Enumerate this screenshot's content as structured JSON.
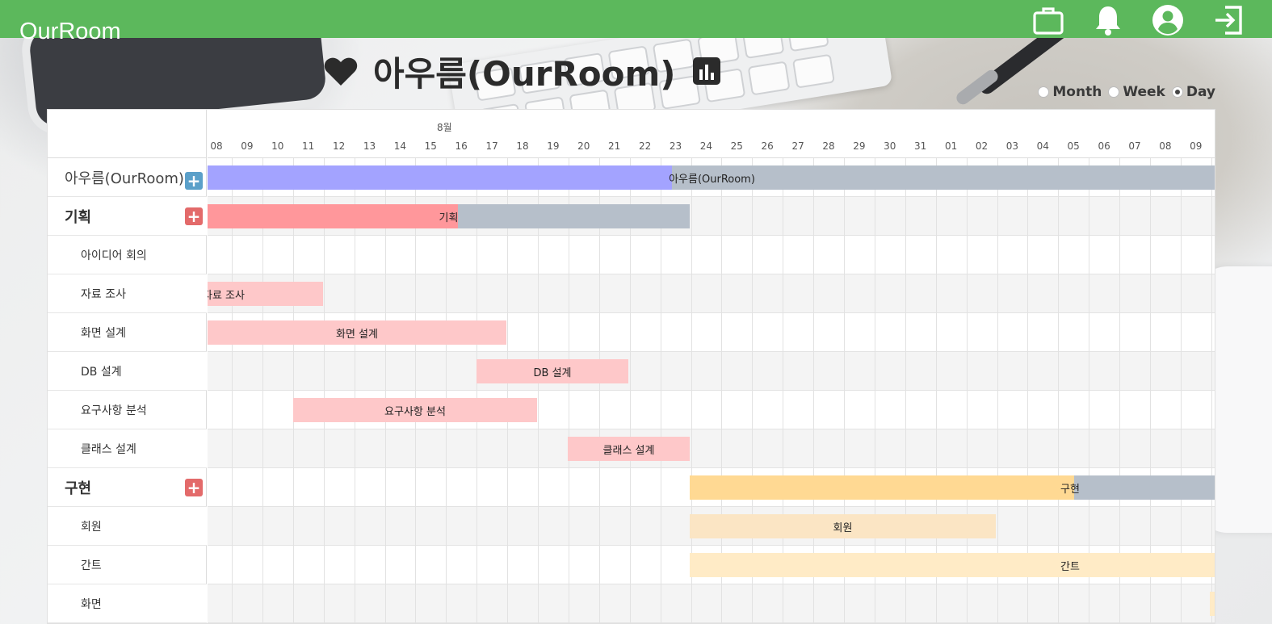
{
  "navbar": {
    "brand": "OurRoom",
    "icons": [
      "briefcase-icon",
      "bell-icon",
      "user-circle-icon",
      "sign-out-icon"
    ],
    "color": "#5cb85c"
  },
  "header": {
    "title": "아우름(OurRoom)",
    "heart_icon": "heart-icon",
    "stats_icon": "bar-chart-icon"
  },
  "view_modes": {
    "options": [
      {
        "label": "Month",
        "checked": false
      },
      {
        "label": "Week",
        "checked": false
      },
      {
        "label": "Day",
        "checked": true
      }
    ]
  },
  "timeline": {
    "month": "8월",
    "days": [
      "08",
      "09",
      "10",
      "11",
      "12",
      "13",
      "14",
      "15",
      "16",
      "17",
      "18",
      "19",
      "20",
      "21",
      "22",
      "23",
      "24",
      "25",
      "26",
      "27",
      "28",
      "29",
      "30",
      "31",
      "01",
      "02",
      "03",
      "04",
      "05",
      "06",
      "07",
      "08",
      "09"
    ]
  },
  "tasks": [
    {
      "name": "아우름(OurRoom)",
      "level": "project",
      "add_button": "blue",
      "bar_label": "아우름(OurRoom)",
      "progress": 0.46,
      "bar_color": "#a3a3ff",
      "rest_color": "#b6bfca"
    },
    {
      "name": "기획",
      "level": "phase",
      "add_button": "red",
      "bar_label": "기획",
      "progress": 0.52,
      "bar_color": "#ff979b",
      "rest_color": "#b6bfca"
    },
    {
      "name": "아이디어 회의",
      "level": "sub"
    },
    {
      "name": "자료 조사",
      "level": "sub",
      "bar_label": "자료 조사",
      "bar_color": "#fec8c9"
    },
    {
      "name": "화면 설계",
      "level": "sub",
      "bar_label": "화면 설계",
      "bar_color": "#fec8c9"
    },
    {
      "name": "DB 설계",
      "level": "sub",
      "bar_label": "DB 설계",
      "bar_color": "#fec8c9"
    },
    {
      "name": "요구사항 분석",
      "level": "sub",
      "bar_label": "요구사항 분석",
      "bar_color": "#fec8c9"
    },
    {
      "name": "클래스 설계",
      "level": "sub",
      "bar_label": "클래스 설계",
      "bar_color": "#fec8c9"
    },
    {
      "name": "구현",
      "level": "phase",
      "add_button": "red",
      "bar_label": "구현",
      "progress": 0.73,
      "bar_color": "#ffd993",
      "rest_color": "#b6bfca"
    },
    {
      "name": "회원",
      "level": "sub",
      "bar_label": "회원",
      "bar_color": "#fbe5c4"
    },
    {
      "name": "간트",
      "level": "sub",
      "bar_label": "간트",
      "bar_color": "#ffebc6"
    },
    {
      "name": "화면",
      "level": "sub",
      "bar_color": "#ffebc6"
    }
  ]
}
